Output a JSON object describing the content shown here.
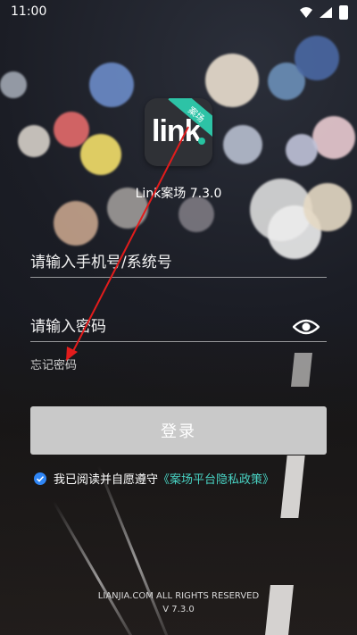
{
  "status": {
    "time": "11:00"
  },
  "app": {
    "logo_text": "link",
    "logo_ribbon": "案场",
    "name_version": "Link案场 7.3.0"
  },
  "login": {
    "phone_placeholder": "请输入手机号/系统号",
    "password_placeholder": "请输入密码",
    "forgot": "忘记密码",
    "button": "登录"
  },
  "agreement": {
    "prefix": "我已阅读并自愿遵守",
    "link": "《案场平台隐私政策》",
    "checked": true
  },
  "footer": {
    "rights": "LIANJIA.COM ALL RIGHTS RESERVED",
    "version": "V 7.3.0"
  },
  "colors": {
    "accent": "#2dc3a6",
    "link": "#49d3c4",
    "checkbox": "#2f86f6",
    "button_bg": "#c9c9c9",
    "annotation_arrow": "#e21c1c"
  }
}
